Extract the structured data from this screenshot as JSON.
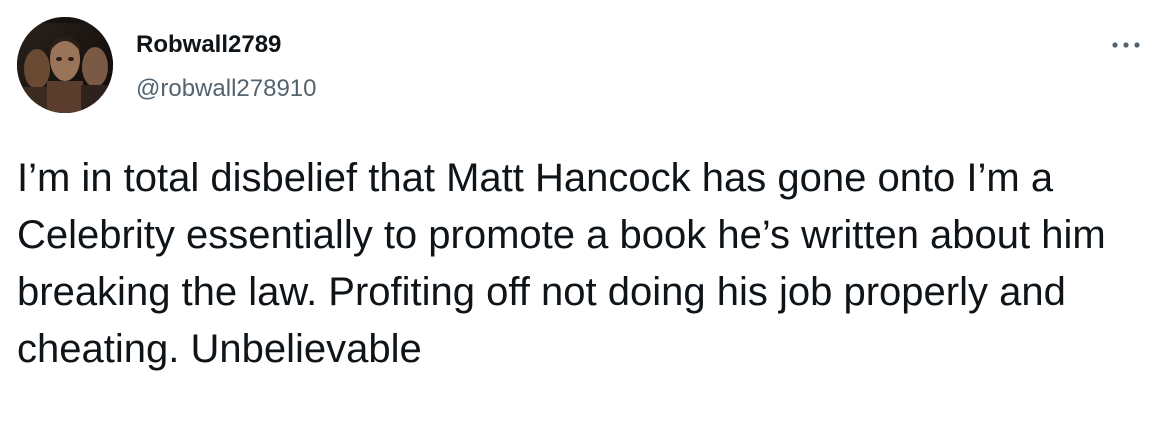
{
  "tweet": {
    "author": {
      "display_name": "Robwall2789",
      "handle": "@robwall278910",
      "avatar_icon": "profile-photo-collage"
    },
    "menu_icon": "more-options-icon",
    "text": "I’m in total disbelief that Matt Hancock has gone onto I’m a Celebrity essentially to promote a book he’s written about him breaking the law. Profiting off not doing his job properly and cheating. Unbelievable"
  },
  "colors": {
    "text_primary": "#0f1419",
    "text_secondary": "#536471",
    "background": "#ffffff"
  }
}
